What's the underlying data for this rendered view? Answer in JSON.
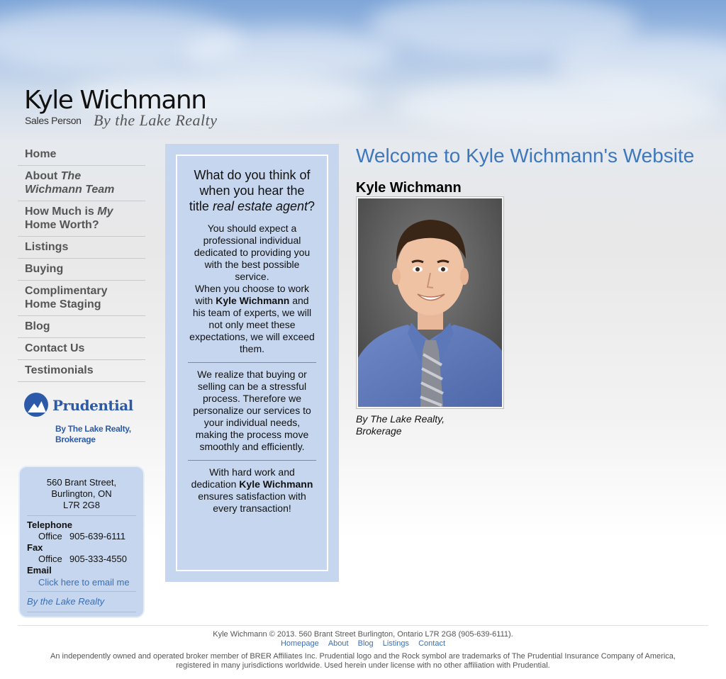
{
  "header": {
    "name": "Kyle Wichmann",
    "role": "Sales Person",
    "brokerage_script": "By the Lake Realty"
  },
  "nav": {
    "home": "Home",
    "about_prefix": "About ",
    "about_em": "The Wichmann Team",
    "howmuch_prefix": "How Much is ",
    "howmuch_em": "My",
    "howmuch_suffix": " Home Worth?",
    "listings": "Listings",
    "buying": "Buying",
    "staging": "Complimentary Home Staging",
    "blog": "Blog",
    "contact": "Contact Us",
    "testimonials": "Testimonials"
  },
  "logo": {
    "word": "Prudential",
    "sub_line1": "By The Lake Realty,",
    "sub_line2": "Brokerage"
  },
  "contact_box": {
    "address_line1": "560 Brant Street,",
    "address_line2": "Burlington, ON",
    "address_line3": "L7R 2G8",
    "telephone_label": "Telephone",
    "telephone_office_label": "Office",
    "telephone_office": "905-639-6111",
    "fax_label": "Fax",
    "fax_office_label": "Office",
    "fax_office": "905-333-4550",
    "email_label": "Email",
    "email_link": "Click here to email me",
    "brand_link": "By the Lake Realty"
  },
  "middle": {
    "q_part1": "What do you think of when you hear the title ",
    "q_em": "real estate agent",
    "q_part2": "?",
    "p1": "You should expect a professional individual dedicated to providing you with the best possible service.",
    "p2_a": "When you choose to work with ",
    "p2_b": "Kyle Wichmann",
    "p2_c": " and his team of experts, we will not only meet these expectations, we will exceed them.",
    "p3": "We realize that buying or selling can be a stressful process. Therefore we personalize our services to your individual needs, making the process move smoothly and efficiently.",
    "p4_a": "With hard work and dedication ",
    "p4_b": "Kyle Wichmann",
    "p4_c": " ensures satisfaction with every transaction!"
  },
  "main": {
    "title": "Welcome to Kyle Wichmann's Website",
    "name": "Kyle Wichmann",
    "caption_line1": "By The Lake Realty,",
    "caption_line2": "Brokerage"
  },
  "footer": {
    "copy": "Kyle Wichmann © 2013. 560 Brant Street Burlington, Ontario L7R 2G8 (905-639-6111).",
    "links": [
      "Homepage",
      "About",
      "Blog",
      "Listings",
      "Contact"
    ],
    "legal_line1": "An independently owned and operated broker member of BRER Affiliates Inc. Prudential logo and the Rock symbol are trademarks of The Prudential Insurance Company of America,",
    "legal_line2": "registered in many jurisdictions worldwide. Used herein under license with no other affiliation with Prudential."
  },
  "colors": {
    "accent": "#3d78bd",
    "panel": "#c5d6ee",
    "link": "#3d6fb0"
  }
}
